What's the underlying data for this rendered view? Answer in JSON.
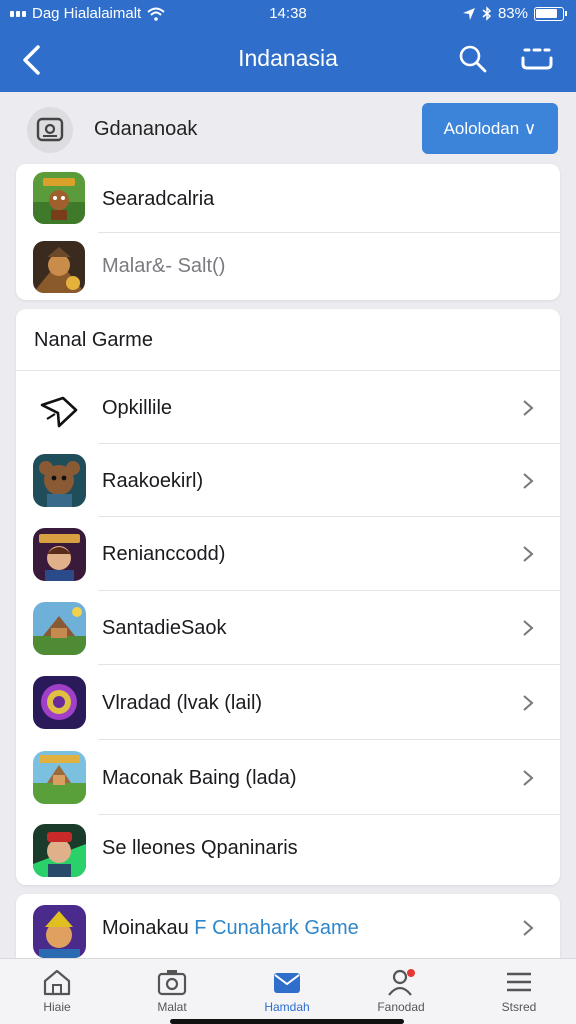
{
  "status_bar": {
    "carrier": "Dag Hialalaimalt",
    "time": "14:38",
    "battery": "83%",
    "battery_level": 0.83,
    "icons": [
      "signal-dots-icon",
      "wifi-icon",
      "location-arrow-icon",
      "bluetooth-icon",
      "battery-icon"
    ]
  },
  "nav": {
    "title": "Indanasia",
    "icons": [
      "back-chevron-icon",
      "search-icon",
      "more-icon"
    ]
  },
  "top_row": {
    "label": "Gdananoak",
    "button_label": "Aololodan ∨",
    "icon": "camera-icon"
  },
  "recent_items": [
    {
      "label": "Searadcalria",
      "muted": false
    },
    {
      "label": "Malar&- Salt()",
      "muted": true
    }
  ],
  "games_section": {
    "title": "Nanal Garme",
    "items": [
      {
        "label": "Opkillile",
        "icon": "pen-nib-icon",
        "chevron": true
      },
      {
        "label": "Raakoekirl)",
        "icon": "game-thumbnail-icon",
        "chevron": true
      },
      {
        "label": "Renianccodd)",
        "icon": "game-thumbnail-icon",
        "chevron": true
      },
      {
        "label": "SantadieSaok",
        "icon": "game-thumbnail-icon",
        "chevron": true
      },
      {
        "label": "Vlradad (lvak (lail)",
        "icon": "game-thumbnail-icon",
        "chevron": true
      },
      {
        "label": "Maconak Baing (lada)",
        "icon": "game-thumbnail-icon",
        "chevron": true
      },
      {
        "label": "Se lleones Qpaninaris",
        "icon": "game-thumbnail-icon",
        "chevron": false
      }
    ]
  },
  "promo_row": {
    "label": "Moinakau",
    "marker": "F",
    "highlight": "Cunahark Game"
  },
  "tabs": [
    {
      "label": "Hiaie",
      "icon": "home-icon",
      "active": false
    },
    {
      "label": "Malat",
      "icon": "camera-icon",
      "active": false
    },
    {
      "label": "Hamdah",
      "icon": "mail-icon",
      "active": true
    },
    {
      "label": "Fanodad",
      "icon": "person-icon",
      "active": false
    },
    {
      "label": "Stsred",
      "icon": "menu-icon",
      "active": false
    }
  ],
  "colors": {
    "header_blue": "#2f6ecb",
    "button_blue": "#3c83da",
    "highlight_blue": "#2f86c9",
    "background": "#ececf0",
    "notification_red": "#e53935"
  }
}
